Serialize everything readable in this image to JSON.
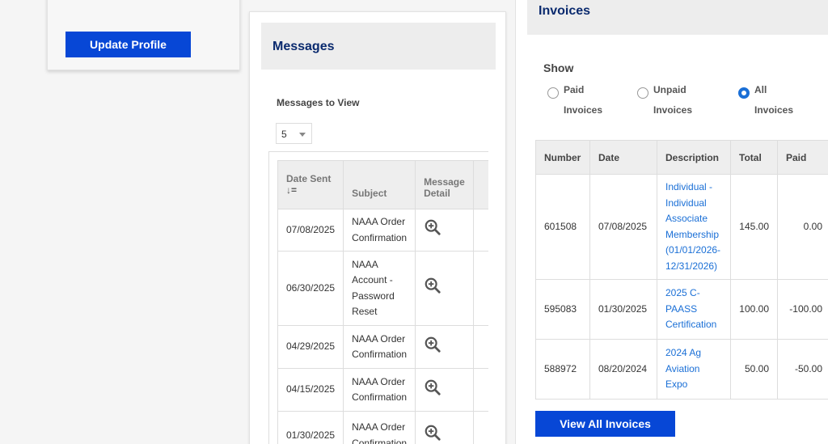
{
  "profile": {
    "update_label": "Update Profile"
  },
  "messages": {
    "title": "Messages",
    "view_label": "Messages to View",
    "view_count": "5",
    "columns": {
      "date": "Date Sent",
      "sort_icon": "↓=",
      "subject": "Subject",
      "detail_line1": "Message",
      "detail_line2": "Detail"
    },
    "rows": [
      {
        "date": "07/08/2025",
        "subject": "NAAA Order Confirmation"
      },
      {
        "date": "06/30/2025",
        "subject": "NAAA Account - Password Reset"
      },
      {
        "date": "04/29/2025",
        "subject": "NAAA Order Confirmation"
      },
      {
        "date": "04/15/2025",
        "subject": "NAAA Order Confirmation"
      },
      {
        "date": "01/30/2025",
        "subject": "NAAA Order Confirmation"
      }
    ],
    "detail_icon": "magnifier-plus-icon"
  },
  "invoices": {
    "title": "Invoices",
    "show_label": "Show",
    "filters": [
      {
        "line1": "Paid",
        "line2": "Invoices",
        "checked": false
      },
      {
        "line1": "Unpaid",
        "line2": "Invoices",
        "checked": false
      },
      {
        "line1": "All",
        "line2": "Invoices",
        "checked": true
      }
    ],
    "columns": {
      "number": "Number",
      "date": "Date",
      "description": "Description",
      "total": "Total",
      "paid": "Paid"
    },
    "rows": [
      {
        "number": "601508",
        "date": "07/08/2025",
        "description": "Individual - Individual Associate Membership (01/01/2026-12/31/2026)",
        "total": "145.00",
        "paid": "0.00"
      },
      {
        "number": "595083",
        "date": "01/30/2025",
        "description": "2025 C-PAASS Certification",
        "total": "100.00",
        "paid": "-100.00"
      },
      {
        "number": "588972",
        "date": "08/20/2024",
        "description": "2024 Ag Aviation Expo",
        "total": "50.00",
        "paid": "-50.00"
      }
    ],
    "view_all_label": "View All Invoices"
  },
  "colors": {
    "primary_button": "#0747d6",
    "heading": "#0a2a6e",
    "link": "#1a6fd6"
  }
}
